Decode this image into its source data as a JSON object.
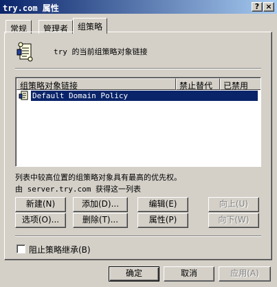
{
  "window": {
    "title": "try.com 属性",
    "help_label": "?",
    "close_label": "×"
  },
  "tabs": [
    {
      "label": "常规",
      "active": false
    },
    {
      "label": "管理者",
      "active": false
    },
    {
      "label": "组策略",
      "active": true
    }
  ],
  "header": {
    "text": "try 的当前组策略对象链接"
  },
  "list": {
    "columns": [
      "组策略对象链接",
      "禁止替代",
      "已禁用"
    ],
    "rows": [
      {
        "name": "Default Domain Policy",
        "selected": true
      }
    ]
  },
  "info": {
    "priority_text": "列表中较高位置的组策略对象具有最高的优先权。",
    "source_text": "由 server.try.com 获得这一列表"
  },
  "actions": {
    "new": "新建(N)",
    "add": "添加(D)...",
    "edit": "编辑(E)",
    "up": "向上(U)",
    "options": "选项(O)...",
    "delete": "删除(T)...",
    "properties": "属性(P)",
    "down": "向下(W)"
  },
  "block_inheritance": {
    "label": "阻止策略继承(B)",
    "checked": false
  },
  "footer": {
    "ok": "确定",
    "cancel": "取消",
    "apply": "应用(A)"
  },
  "colors": {
    "title_start": "#0a246a",
    "title_end": "#a6caf0",
    "face": "#d4d0c8",
    "selection": "#0a246a"
  }
}
